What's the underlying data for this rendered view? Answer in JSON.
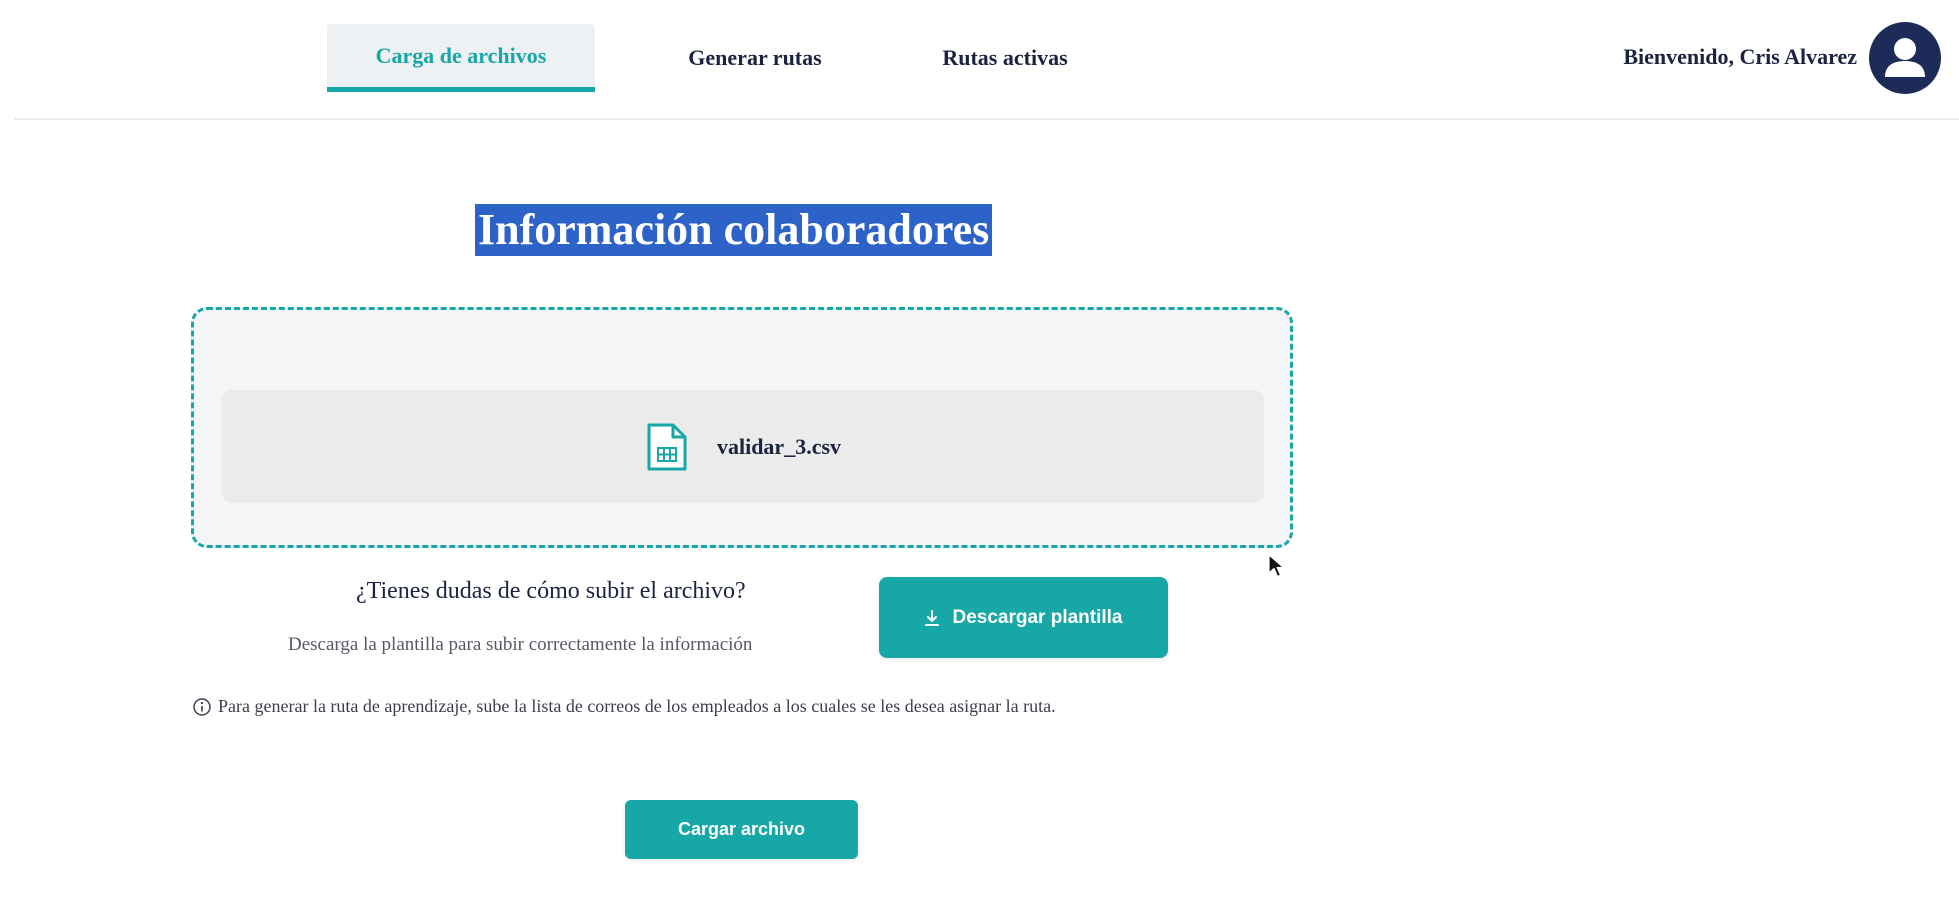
{
  "nav": {
    "tabs": [
      {
        "label": "Carga de archivos",
        "active": true
      },
      {
        "label": "Generar rutas",
        "active": false
      },
      {
        "label": "Rutas activas",
        "active": false
      }
    ],
    "welcome": "Bienvenido, Cris Alvarez",
    "avatar_icon": "user-icon"
  },
  "main": {
    "title": "Información colaboradores",
    "dropzone": {
      "file_name": "validar_3.csv",
      "file_icon": "spreadsheet-file-icon"
    },
    "help": {
      "question": "¿Tienes dudas de cómo subir el archivo?",
      "subtitle": "Descarga la plantilla para subir correctamente la información",
      "download_button": "Descargar plantilla",
      "download_icon": "download-icon"
    },
    "info": {
      "icon": "info-icon",
      "text": "Para generar la ruta de aprendizaje, sube la lista de correos de los empleados a los cuales se les desea asignar la ruta."
    },
    "upload_button": "Cargar archivo"
  },
  "colors": {
    "accent": "#17a7a7",
    "navy": "#1c2b57",
    "title_highlight": "#2d62c8"
  }
}
